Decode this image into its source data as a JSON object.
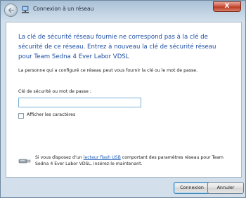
{
  "window": {
    "title": "Connexion à un réseau",
    "close_glyph": "X"
  },
  "main": {
    "headline": "La clé de sécurité réseau fournie ne correspond pas à la clé de sécurité de ce réseau. Entrez à nouveau la clé de sécurité réseau pour Team Sedna 4 Ever Labor VDSL",
    "info": "La personne qui a configuré ce réseau peut vous fournir la clé ou le mot de passe.",
    "key_label": "Clé de sécurité ou mot de passe :",
    "key_value": "",
    "show_chars_label": "Afficher les caractères",
    "show_chars_checked": false,
    "usb_prefix": "Si vous disposez d’un ",
    "usb_link": "lecteur flash USB",
    "usb_suffix": " comportant des paramètres réseau pour Team Sedna 4 Ever Labor VDSL, insérez-le maintenant."
  },
  "buttons": {
    "connect_label": "Connexion",
    "cancel_label": "Annuler"
  },
  "icons": {
    "back": "back-arrow-icon",
    "network": "network-icon",
    "usb": "usb-drive-icon"
  },
  "colors": {
    "headline": "#1e4fa3",
    "link": "#1f5fb8",
    "close_button": "#c9523b"
  }
}
